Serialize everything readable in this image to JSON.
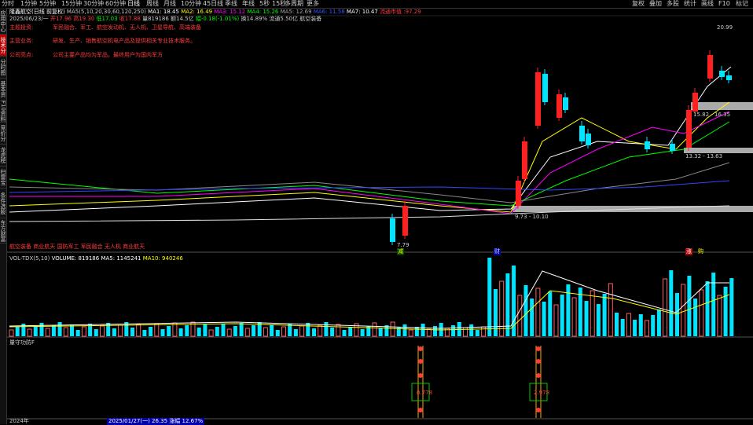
{
  "top_tabs": [
    "分时",
    "1分钟",
    "5分钟",
    "15分钟",
    "30分钟",
    "60分钟",
    "日线",
    "周线",
    "月线",
    "10分钟",
    "45日线",
    "季线",
    "年线",
    "5秒",
    "15秒",
    "多周期",
    "更多"
  ],
  "top_right": [
    "复权",
    "叠加",
    "多股",
    "统计",
    "画线",
    "F10",
    "标记"
  ],
  "sidebar": [
    "应用中心",
    "技术分析",
    "分时图",
    "基本资料",
    "F10资料",
    "竞价分析",
    "龙虎榜",
    "扫雷宝",
    "条件选股",
    "东方财富"
  ],
  "header": {
    "stock": "隆鑫航空(日线 前复权)",
    "ma_params": "MA5(5,10,20,30,60,120,250)",
    "ma1": "MA1: 18.45",
    "ma2": "MA2: 16.49",
    "ma3": "MA3: 15.12",
    "ma4": "MA4: 15.26",
    "ma5": "MA5: 12.69",
    "ma6": "MA6: 11.58",
    "ma7": "MA7: 10.47",
    "flow": "流通市值 :97.29",
    "date_line": "2025/06/23/一",
    "open": "开17.96",
    "high": "高19.30",
    "low": "低17.03",
    "close": "收17.88",
    "vol": "量819186",
    "amount": "额14.5亿",
    "change": "幅-0.18(-1.01%)",
    "turnover": "换14.89%",
    "float_shares": "流通5.50亿",
    "sector": "航空装备"
  },
  "info_rows": [
    {
      "label": "主题投资:",
      "value": "军民融合、军工、航空发动机、无人机、卫星导航、高端装备"
    },
    {
      "label": "主营业务:",
      "value": "研发、生产、销售航空机电产品及提供相关专业技术服务。"
    },
    {
      "label": "公司亮点:",
      "value": "公司主要产品均为军品，最终用户为国内军方"
    }
  ],
  "price_labels": {
    "high_mark": "20.99",
    "low_mark": "7.79",
    "zone_upper": "15.82 - 16.35",
    "zone_mid": "13.32 - 13.63",
    "zone_lower": "9.73 - 10.10"
  },
  "bottom_note": "航空装备 商业航天 国防军工 军民融合 无人机 商业航天",
  "markers": {
    "a": "减",
    "b": "财",
    "c": "涨",
    "d": "购"
  },
  "vol_header": {
    "name": "VOL-TDX(5,10)",
    "volume": "VOLUME: 819186",
    "ma5": "MA5: 1145241",
    "ma10": "MA10: 940246"
  },
  "ind_header": {
    "name": "量守功防F"
  },
  "signal_values": [
    "0.778",
    "2.978"
  ],
  "status": {
    "left": "2024年",
    "mid": "2025/01/27(一)  26.35 涨幅 12.67%"
  },
  "colors": {
    "up": "#ff2020",
    "down": "#00e4ff",
    "ma1": "#ffffff",
    "ma2": "#ffff00",
    "ma3": "#ff00ff",
    "ma4": "#00ff00",
    "ma5": "#808080",
    "ma6": "#0000ff",
    "ma7": "#ffffff"
  }
}
